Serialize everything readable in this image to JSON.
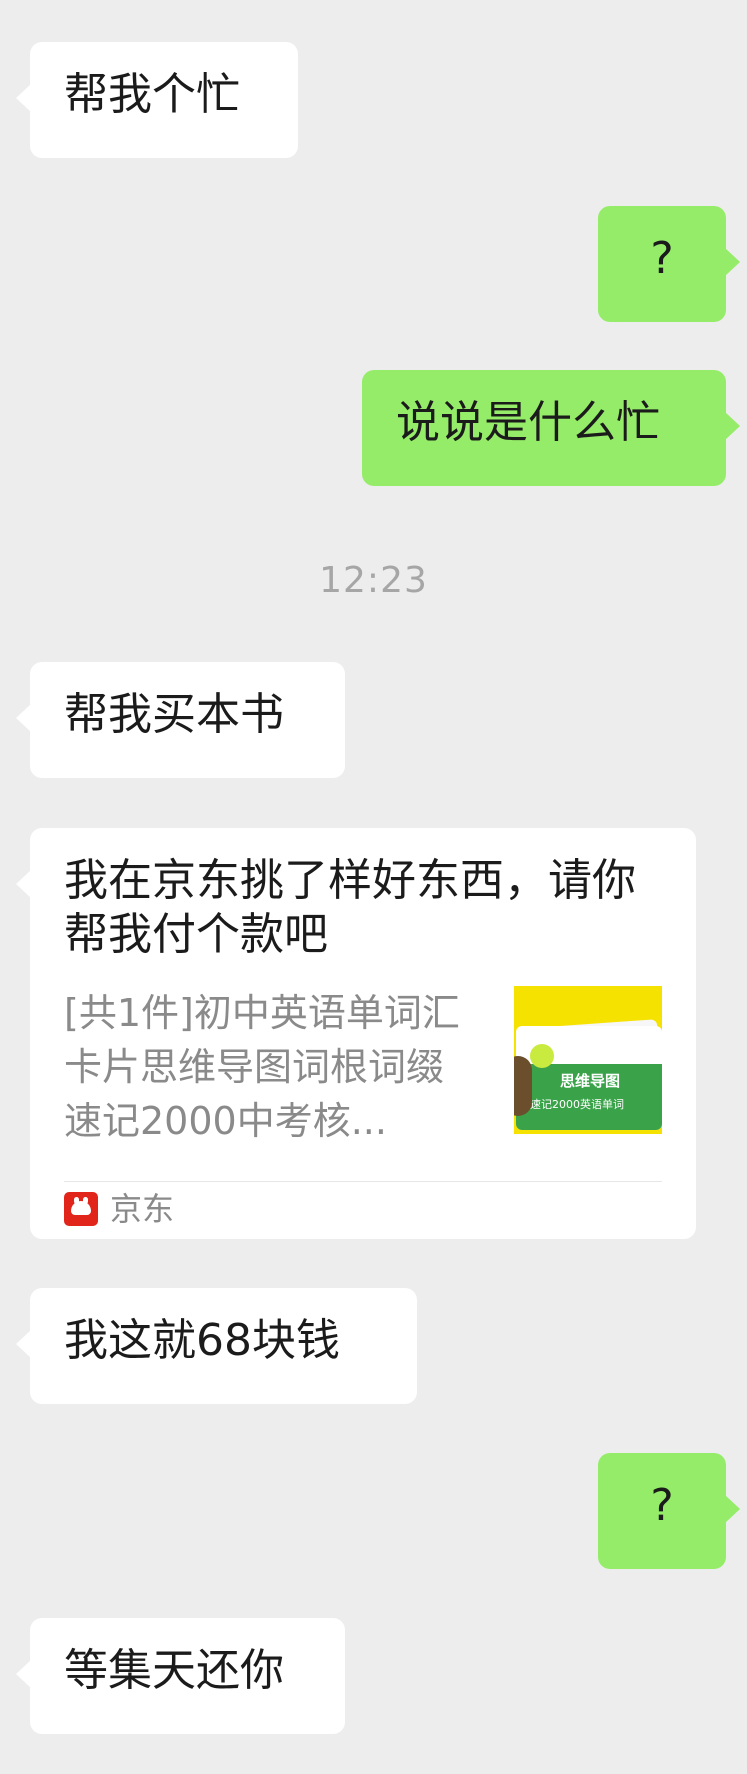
{
  "messages": [
    {
      "side": "left",
      "text": "帮我个忙"
    },
    {
      "side": "right",
      "text": "?"
    },
    {
      "side": "right",
      "text": "说说是什么忙"
    },
    {
      "side": "left",
      "text": "帮我买本书"
    },
    {
      "side": "left",
      "text": "我这就68块钱"
    },
    {
      "side": "right",
      "text": "?"
    },
    {
      "side": "left",
      "text": "等集天还你"
    }
  ],
  "timestamp": "12:23",
  "card": {
    "title": "我在京东挑了样好东西，请你帮我付个款吧",
    "description": "[共1件]初中英语单词汇卡片思维导图词根词缀速记2000中考核...",
    "thumbnail": {
      "line1": "思维导图",
      "line2": "速记2000英语单词",
      "icon": "product-flashcards-image"
    },
    "source": "京东",
    "source_icon": "jd-logo-icon"
  },
  "colors": {
    "background": "#ededed",
    "incoming_bubble": "#ffffff",
    "outgoing_bubble": "#95ec69",
    "timestamp": "#a6a6a6",
    "jd_red": "#e1251b"
  }
}
